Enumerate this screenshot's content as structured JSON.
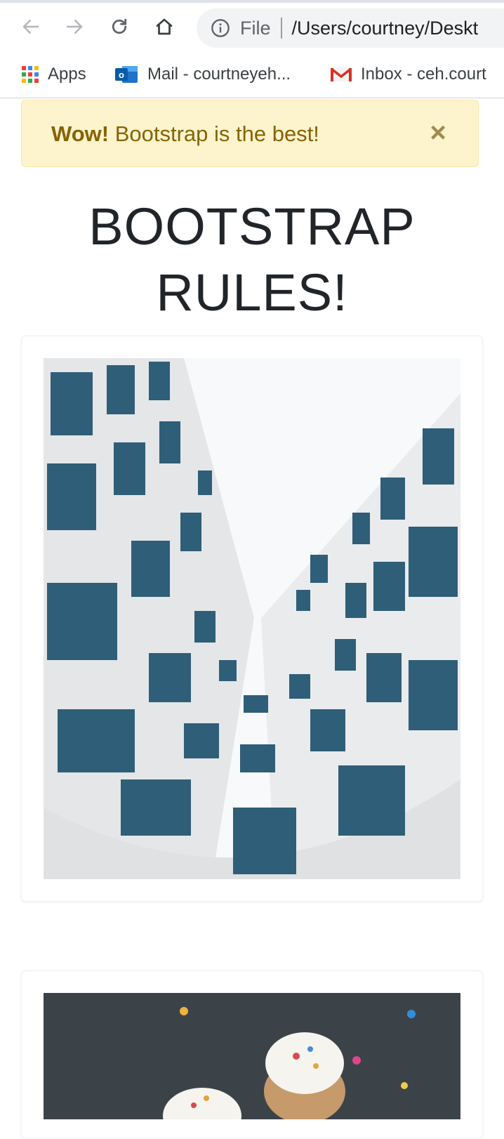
{
  "browser": {
    "omnibox": {
      "scheme": "File",
      "url": "/Users/courtney/Deskt"
    },
    "bookmarks": [
      {
        "label": "Apps",
        "icon": "apps-grid-icon"
      },
      {
        "label": "Mail - courtneyeh...",
        "icon": "outlook-icon"
      },
      {
        "label": "Inbox - ceh.court",
        "icon": "gmail-icon"
      }
    ]
  },
  "alert": {
    "strong": "Wow!",
    "message": " Bootstrap is the best!",
    "close_label": "×",
    "bg_color": "#fdf3cd",
    "text_color": "#856404"
  },
  "page": {
    "heading_line1": "BOOTSTRAP",
    "heading_line2": "RULES!"
  },
  "cards": [
    {
      "image": "building-windows-upward-photo"
    },
    {
      "image": "cupcakes-photo"
    }
  ]
}
